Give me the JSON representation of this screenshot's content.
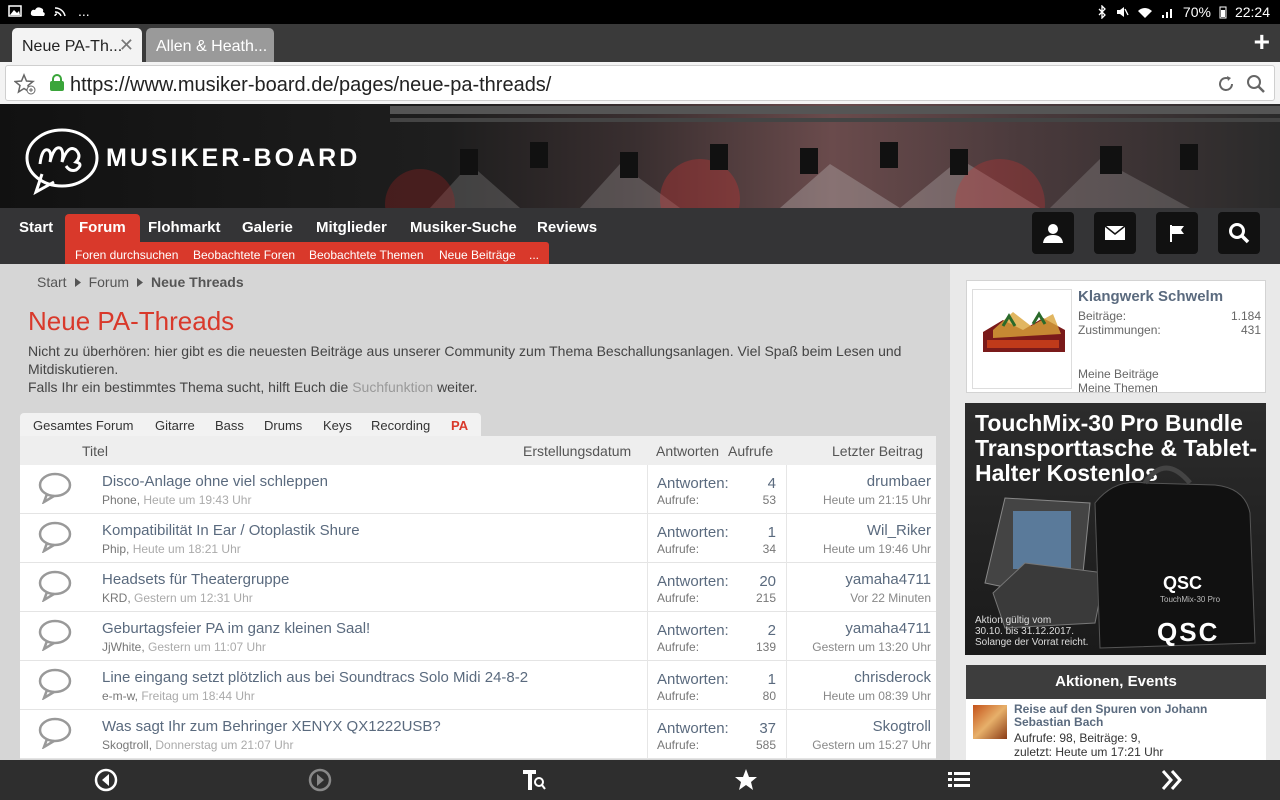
{
  "status_bar": {
    "battery": "70%",
    "time": "22:24",
    "left_more": "..."
  },
  "browser": {
    "tabs": [
      {
        "label": "Neue PA-Th..."
      },
      {
        "label": "Allen & Heath..."
      }
    ],
    "url": "https://www.musiker-board.de/pages/neue-pa-threads/"
  },
  "site": {
    "logo_text": "MUSIKER-BOARD"
  },
  "nav": {
    "items": [
      {
        "label": "Start"
      },
      {
        "label": "Forum"
      },
      {
        "label": "Flohmarkt"
      },
      {
        "label": "Galerie"
      },
      {
        "label": "Mitglieder"
      },
      {
        "label": "Musiker-Suche"
      },
      {
        "label": "Reviews"
      }
    ],
    "subitems": [
      {
        "label": "Foren durchsuchen"
      },
      {
        "label": "Beobachtete Foren"
      },
      {
        "label": "Beobachtete Themen"
      },
      {
        "label": "Neue Beiträge"
      },
      {
        "label": "..."
      }
    ]
  },
  "breadcrumb": [
    {
      "label": "Start"
    },
    {
      "label": "Forum"
    },
    {
      "label": "Neue Threads"
    }
  ],
  "page": {
    "title": "Neue PA-Threads",
    "desc1": "Nicht zu überhören: hier gibt es die neuesten Beiträge aus unserer Community zum Thema Beschallungsanlagen. Viel Spaß beim Lesen und Mitdiskutieren.",
    "desc2_pre": "Falls Ihr ein bestimmtes Thema sucht, hilft Euch die",
    "desc2_link": "Suchfunktion",
    "desc2_post": "weiter."
  },
  "forum_tabs": [
    {
      "label": "Gesamtes Forum"
    },
    {
      "label": "Gitarre"
    },
    {
      "label": "Bass"
    },
    {
      "label": "Drums"
    },
    {
      "label": "Keys"
    },
    {
      "label": "Recording"
    },
    {
      "label": "PA"
    }
  ],
  "table": {
    "headers": {
      "title": "Titel",
      "created": "Erstellungsdatum",
      "replies": "Antworten",
      "views": "Aufrufe",
      "last": "Letzter Beitrag"
    },
    "labels": {
      "replies": "Antworten:",
      "views": "Aufrufe:"
    },
    "rows": [
      {
        "title": "Disco-Anlage ohne viel schleppen",
        "author": "Phone,",
        "date": "Heute um 19:43 Uhr",
        "replies": "4",
        "views": "53",
        "last_user": "drumbaer",
        "last_time": "Heute um 21:15 Uhr"
      },
      {
        "title": "Kompatibilität In Ear / Otoplastik Shure",
        "author": "Phip,",
        "date": "Heute um 18:21 Uhr",
        "replies": "1",
        "views": "34",
        "last_user": "Wil_Riker",
        "last_time": "Heute um 19:46 Uhr"
      },
      {
        "title": "Headsets für Theatergruppe",
        "author": "KRD,",
        "date": "Gestern um 12:31 Uhr",
        "replies": "20",
        "views": "215",
        "last_user": "yamaha4711",
        "last_time": "Vor 22 Minuten"
      },
      {
        "title": "Geburtagsfeier PA im ganz kleinen Saal!",
        "author": "JjWhite,",
        "date": "Gestern um 11:07 Uhr",
        "replies": "2",
        "views": "139",
        "last_user": "yamaha4711",
        "last_time": "Gestern um 13:20 Uhr"
      },
      {
        "title": "Line eingang setzt plötzlich aus bei Soundtracs Solo Midi 24-8-2",
        "author": "e-m-w,",
        "date": "Freitag um 18:44 Uhr",
        "replies": "1",
        "views": "80",
        "last_user": "chrisderock",
        "last_time": "Heute um 08:39 Uhr"
      },
      {
        "title": "Was sagt Ihr zum Behringer XENYX QX1222USB?",
        "author": "Skogtroll,",
        "date": "Donnerstag um 21:07 Uhr",
        "replies": "37",
        "views": "585",
        "last_user": "Skogtroll",
        "last_time": "Gestern um 15:27 Uhr"
      }
    ]
  },
  "sidebar": {
    "user": {
      "name": "Klangwerk Schwelm",
      "posts_label": "Beiträge:",
      "posts": "1.184",
      "likes_label": "Zustimmungen:",
      "likes": "431",
      "link1": "Meine Beiträge",
      "link2": "Meine Themen"
    },
    "ad": {
      "title": "TouchMix-30 Pro Bundle Transporttasche & Tablet-Halter Kostenlos",
      "note1": "Aktion gültig vom",
      "note2": "30.10. bis 31.12.2017.",
      "note3": "Solange der Vorrat reicht.",
      "brand": "QSC",
      "bag_brand": "QSC",
      "bag_sub": "TouchMix-30 Pro"
    },
    "events": {
      "title": "Aktionen, Events",
      "item_title": "Reise auf den Spuren von Johann Sebastian Bach",
      "item_stats": "Aufrufe: 98, Beiträge: 9,",
      "item_last": "zuletzt: Heute um 17:21 Uhr"
    }
  },
  "colors": {
    "accent": "#d9392b",
    "nav_bg": "#343436",
    "link": "#5a6a7e"
  }
}
